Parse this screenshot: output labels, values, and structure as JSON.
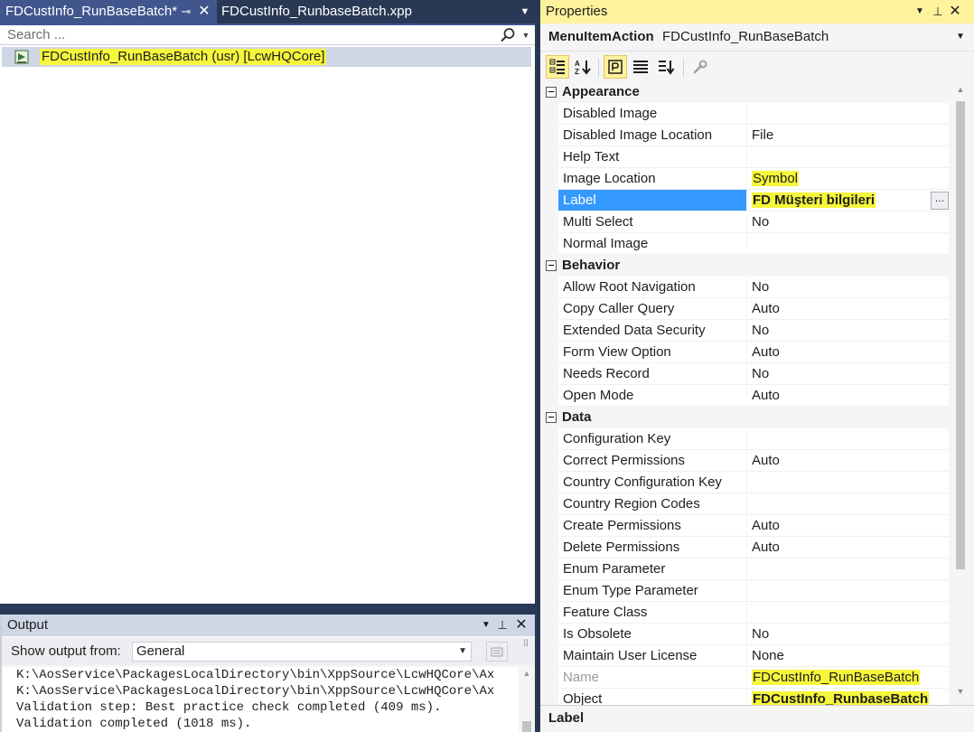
{
  "designer": {
    "active_tab_title": "FDCustInfo_RunBaseBatch*",
    "active_tab_pin": "⊸",
    "active_tab_close": "✕",
    "inactive_tab_title": "FDCustInfo_RunbaseBatch.xpp",
    "search_placeholder": "Search ...",
    "search_icon": "search-icon",
    "tree_node_icon": "menu-item-action-icon",
    "tree_node_label": "FDCustInfo_RunBaseBatch (usr) [LcwHQCore]"
  },
  "output": {
    "title": "Output",
    "show_output_from_label": "Show output from:",
    "source_selected": "General",
    "lines": [
      "K:\\AosService\\PackagesLocalDirectory\\bin\\XppSource\\LcwHQCore\\Ax",
      "K:\\AosService\\PackagesLocalDirectory\\bin\\XppSource\\LcwHQCore\\Ax",
      "Validation step: Best practice check completed (409 ms).",
      "Validation completed (1018 ms)."
    ]
  },
  "properties": {
    "title": "Properties",
    "object_type": "MenuItemAction",
    "object_name": "FDCustInfo_RunBaseBatch",
    "toolbar_icons": [
      "categorized-icon",
      "alphabetical-icon",
      "properties-icon",
      "events-icon",
      "sort-icon",
      "wrench-icon"
    ],
    "categories": [
      {
        "name": "Appearance",
        "rows": [
          {
            "name": "Disabled Image",
            "value": ""
          },
          {
            "name": "Disabled Image Location",
            "value": "File"
          },
          {
            "name": "Help Text",
            "value": ""
          },
          {
            "name": "Image Location",
            "value": "Symbol"
          },
          {
            "name": "Label",
            "value": "FD Müşteri bilgileri"
          },
          {
            "name": "Multi Select",
            "value": "No"
          },
          {
            "name": "Normal Image",
            "value": ""
          }
        ]
      },
      {
        "name": "Behavior",
        "rows": [
          {
            "name": "Allow Root Navigation",
            "value": "No"
          },
          {
            "name": "Copy Caller Query",
            "value": "Auto"
          },
          {
            "name": "Extended Data Security",
            "value": "No"
          },
          {
            "name": "Form View Option",
            "value": "Auto"
          },
          {
            "name": "Needs Record",
            "value": "No"
          },
          {
            "name": "Open Mode",
            "value": "Auto"
          }
        ]
      },
      {
        "name": "Data",
        "rows": [
          {
            "name": "Configuration Key",
            "value": ""
          },
          {
            "name": "Correct Permissions",
            "value": "Auto"
          },
          {
            "name": "Country Configuration Key",
            "value": ""
          },
          {
            "name": "Country Region Codes",
            "value": ""
          },
          {
            "name": "Create Permissions",
            "value": "Auto"
          },
          {
            "name": "Delete Permissions",
            "value": "Auto"
          },
          {
            "name": "Enum Parameter",
            "value": ""
          },
          {
            "name": "Enum Type Parameter",
            "value": ""
          },
          {
            "name": "Feature Class",
            "value": ""
          },
          {
            "name": "Is Obsolete",
            "value": "No"
          },
          {
            "name": "Maintain User License",
            "value": "None"
          },
          {
            "name": "Name",
            "value": "FDCustInfo_RunBaseBatch"
          },
          {
            "name": "Object",
            "value": "FDCustInfo_RunbaseBatch"
          }
        ]
      }
    ],
    "description_title": "Label",
    "colors": {
      "selected_row": "#3399ff",
      "highlight": "#f6f63c",
      "title_active": "#fff29d",
      "frame": "#293955"
    }
  }
}
